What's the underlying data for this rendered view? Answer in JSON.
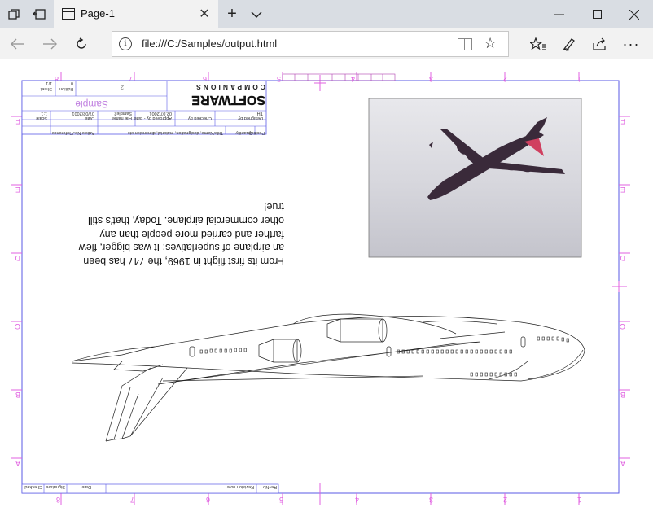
{
  "browser": {
    "tab_title": "Page-1",
    "url": "file:///C:/Samples/output.html"
  },
  "drawing": {
    "paragraph_lines": [
      "From its first flight in 1969, the 747 has been",
      "an airplane of superlatives: It was bigger, flew",
      "farther and carried more people than any",
      "other commercial airplane. Today, that's still",
      "true!"
    ],
    "logo_main": "SOFTWARE",
    "logo_sub": "COMPANIONS",
    "sample_text": "Sample",
    "title_block": {
      "sheet_label": "Sheet",
      "sheet_value": "1/1",
      "edition_label": "Edition",
      "edition_value": "0",
      "rev_value": "2",
      "designed_by_label": "Designed by",
      "designed_by_value": "TH",
      "checked_by_label": "Checked by",
      "approved_label": "Approved by - date",
      "approved_value": "02.07.2001",
      "filename_label": "File name",
      "filename_value": "Sample2",
      "date_label": "Date",
      "date_value": "07/02/2001",
      "scale_label": "Scale",
      "scale_value": "1:1",
      "position_label": "Position",
      "quantity_label": "Quantity",
      "title_label": "Title/Name, designation, material, dimension etc",
      "article_label": "Article No./Reference"
    },
    "revision_block": {
      "revno_label": "RevNo",
      "revision_note_label": "Revision note",
      "date_label": "Date",
      "signature_label": "Signature",
      "checked_label": "Checked"
    },
    "border_labels": {
      "columns": [
        "8",
        "7",
        "6",
        "5",
        "4",
        "3",
        "2",
        "1"
      ],
      "rows": [
        "F",
        "E",
        "D",
        "C",
        "B",
        "A"
      ]
    }
  }
}
